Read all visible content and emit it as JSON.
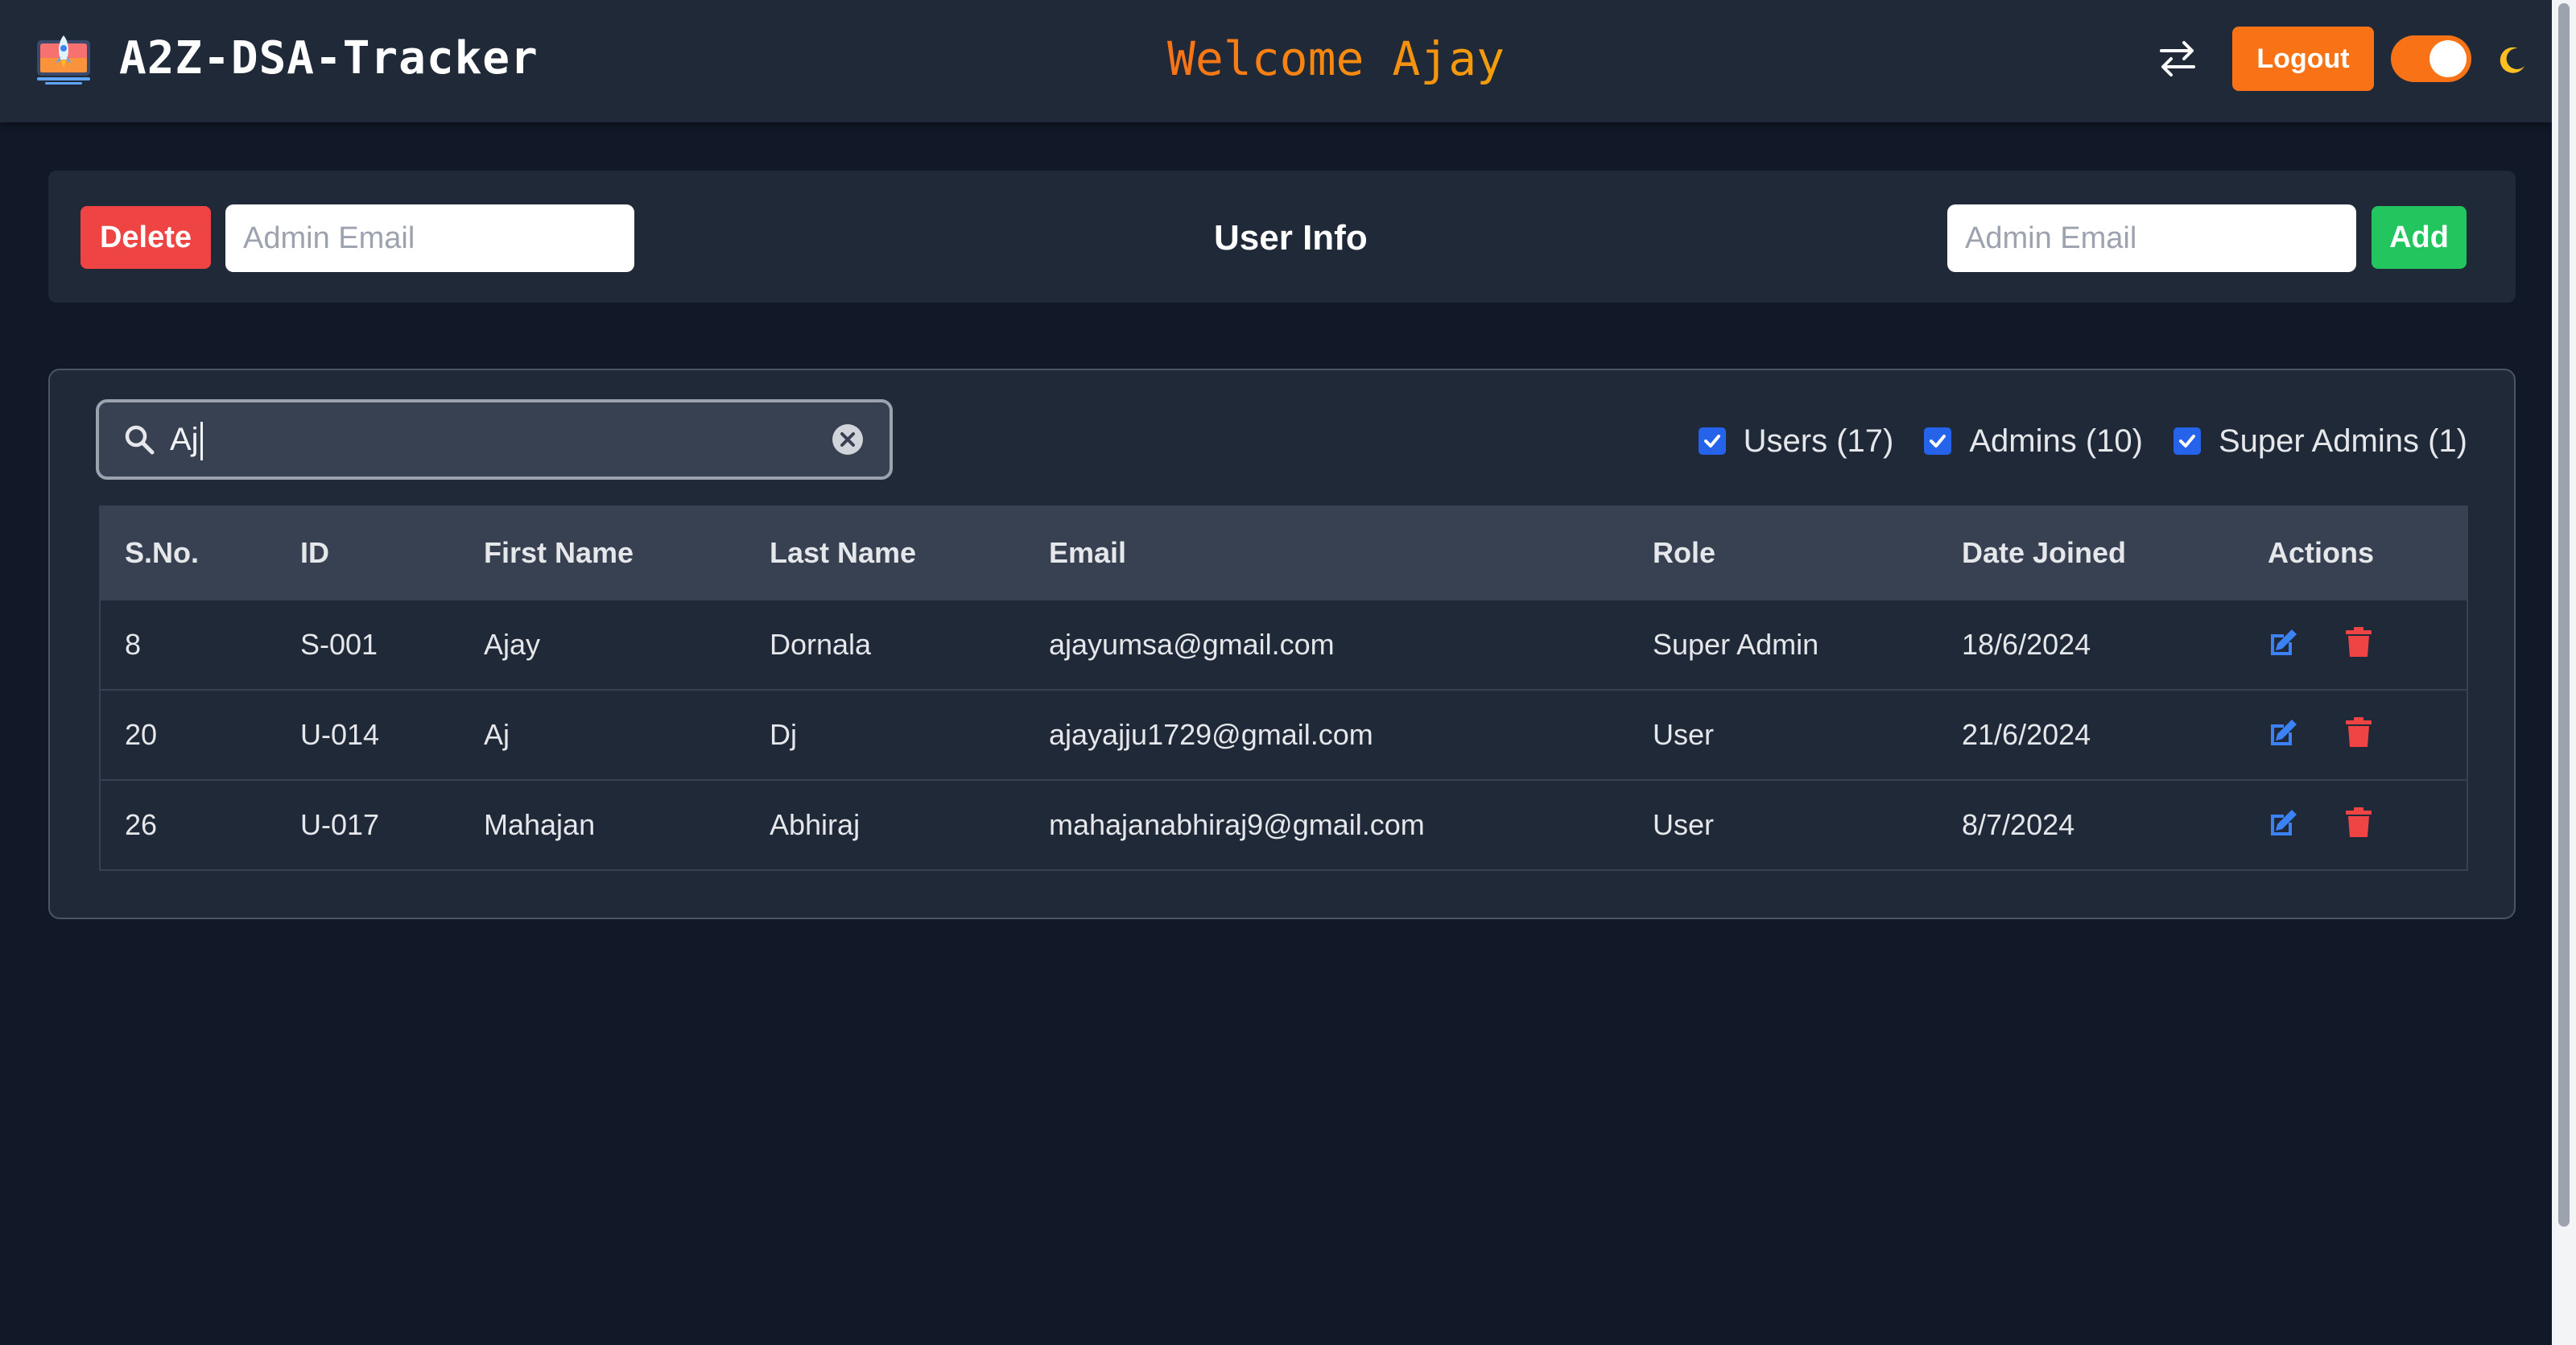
{
  "header": {
    "brand": "A2Z-DSA-Tracker",
    "welcome": "Welcome Ajay",
    "logout_label": "Logout",
    "theme_toggle": "on",
    "accent_color": "#f97316"
  },
  "admin_bar": {
    "delete_label": "Delete",
    "delete_email_placeholder": "Admin Email",
    "title": "User Info",
    "add_email_placeholder": "Admin Email",
    "add_label": "Add",
    "delete_color": "#ef4444",
    "add_color": "#22c55e"
  },
  "search": {
    "value": "Aj"
  },
  "filters": [
    {
      "label": "Users (17)",
      "checked": true
    },
    {
      "label": "Admins (10)",
      "checked": true
    },
    {
      "label": "Super Admins (1)",
      "checked": true
    }
  ],
  "table": {
    "headers": [
      "S.No.",
      "ID",
      "First Name",
      "Last Name",
      "Email",
      "Role",
      "Date Joined",
      "Actions"
    ],
    "rows": [
      {
        "sno": "8",
        "id": "S-001",
        "first": "Ajay",
        "last": "Dornala",
        "email": "ajayumsa@gmail.com",
        "role": "Super Admin",
        "joined": "18/6/2024"
      },
      {
        "sno": "20",
        "id": "U-014",
        "first": "Aj",
        "last": "Dj",
        "email": "ajayajju1729@gmail.com",
        "role": "User",
        "joined": "21/6/2024"
      },
      {
        "sno": "26",
        "id": "U-017",
        "first": "Mahajan",
        "last": "Abhiraj",
        "email": "mahajanabhiraj9@gmail.com",
        "role": "User",
        "joined": "8/7/2024"
      }
    ],
    "action_icons": [
      "edit-icon",
      "trash-icon"
    ],
    "edit_color": "#3b82f6",
    "trash_color": "#ef4444"
  }
}
